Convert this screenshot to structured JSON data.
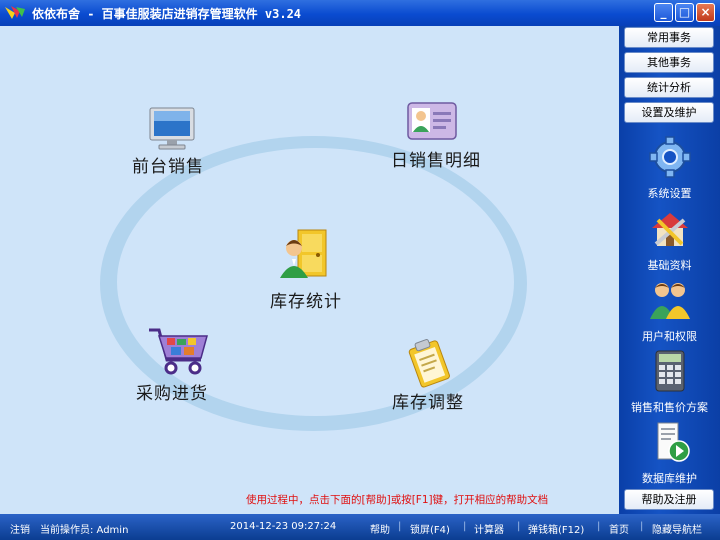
{
  "window": {
    "title": "依依布舍 - 百事佳服装店进销存管理软件 v3.24",
    "minimize_glyph": "_",
    "maximize_glyph": "□",
    "close_glyph": "×"
  },
  "modules": {
    "front_sales": {
      "label": "前台销售",
      "icon": "monitor-icon"
    },
    "daily_sales_detail": {
      "label": "日销售明细",
      "icon": "id-card-icon"
    },
    "inventory_stats": {
      "label": "库存统计",
      "icon": "user-door-icon"
    },
    "purchase": {
      "label": "采购进货",
      "icon": "shopping-cart-icon"
    },
    "inventory_adjust": {
      "label": "库存调整",
      "icon": "clipboard-icon"
    }
  },
  "help_hint": "使用过程中，点击下面的[帮助]或按[F1]键，打开相应的帮助文档",
  "side_tabs": [
    "常用事务",
    "其他事务",
    "统计分析",
    "设置及维护"
  ],
  "side_nav": [
    {
      "label": "系统设置",
      "icon": "gear-icon"
    },
    {
      "label": "基础资料",
      "icon": "house-tools-icon"
    },
    {
      "label": "用户和权限",
      "icon": "users-icon"
    },
    {
      "label": "销售和售价方案",
      "icon": "calculator-icon"
    },
    {
      "label": "数据库维护",
      "icon": "database-play-icon"
    }
  ],
  "help_register": "帮助及注册",
  "status": {
    "logout": "注销",
    "operator": "当前操作员: Admin",
    "datetime": "2014-12-23 09:27:24",
    "links": [
      "帮助",
      "锁屏(F4)",
      "计算器",
      "弹钱箱(F12)",
      "首页",
      "隐藏导航栏"
    ]
  },
  "colors": {
    "title_bar": "#0a4bd0",
    "panel": "#1553c4",
    "background": "#cfe4f9",
    "hint_text": "#e01010"
  }
}
